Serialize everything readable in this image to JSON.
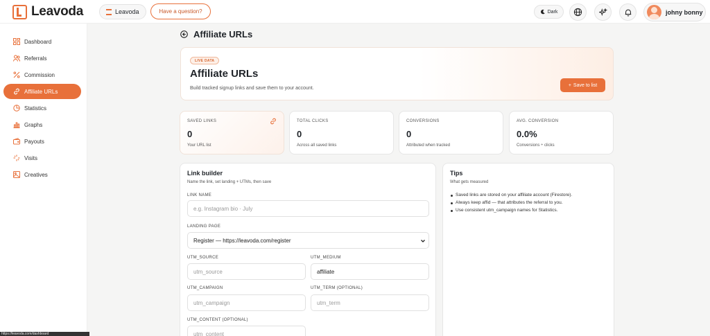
{
  "brand": {
    "logo_text": "Leavoda",
    "pill_label": "Leavoda"
  },
  "topbar": {
    "question_label": "Have a question?",
    "dark_label": "Dark",
    "user_name": "johny bonny"
  },
  "sidebar": {
    "items": [
      {
        "label": "Dashboard",
        "icon": "grid-icon",
        "active": false
      },
      {
        "label": "Referrals",
        "icon": "users-icon",
        "active": false
      },
      {
        "label": "Commission",
        "icon": "percent-icon",
        "active": false
      },
      {
        "label": "Affiliate URLs",
        "icon": "link-icon",
        "active": true
      },
      {
        "label": "Statistics",
        "icon": "pie-icon",
        "active": false
      },
      {
        "label": "Graphs",
        "icon": "bar-chart-icon",
        "active": false
      },
      {
        "label": "Payouts",
        "icon": "wallet-icon",
        "active": false
      },
      {
        "label": "Visits",
        "icon": "sparkle-icon",
        "active": false
      },
      {
        "label": "Creatives",
        "icon": "image-icon",
        "active": false
      }
    ]
  },
  "page": {
    "title": "Affiliate URLs"
  },
  "hero": {
    "badge": "LIVE DATA",
    "title": "Affiliate URLs",
    "subtitle": "Build tracked signup links and save them to your account.",
    "save_label": "Save to list"
  },
  "stats": [
    {
      "label": "SAVED LINKS",
      "value": "0",
      "sub": "Your URL list"
    },
    {
      "label": "TOTAL CLICKS",
      "value": "0",
      "sub": "Across all saved links"
    },
    {
      "label": "CONVERSIONS",
      "value": "0",
      "sub": "Attributed when tracked"
    },
    {
      "label": "AVG. CONVERSION",
      "value": "0.0%",
      "sub": "Conversions ÷ clicks"
    }
  ],
  "builder": {
    "title": "Link builder",
    "subtitle": "Name the link, set landing + UTMs, then save",
    "link_name_label": "LINK NAME",
    "link_name_placeholder": "e.g. Instagram bio · July",
    "landing_label": "LANDING PAGE",
    "landing_value": "Register — https://leavoda.com/register",
    "utm_source_label": "UTM_SOURCE",
    "utm_source_placeholder": "utm_source",
    "utm_medium_label": "UTM_MEDIUM",
    "utm_medium_value": "affiliate",
    "utm_campaign_label": "UTM_CAMPAIGN",
    "utm_campaign_placeholder": "utm_campaign",
    "utm_term_label": "UTM_TERM (OPTIONAL)",
    "utm_term_placeholder": "utm_term",
    "utm_content_label": "UTM_CONTENT (OPTIONAL)",
    "utm_content_placeholder": "utm_content"
  },
  "tips": {
    "title": "Tips",
    "subtitle": "What gets measured",
    "items": [
      "Saved links are stored on your affiliate account (Firestore).",
      "Always keep affid — that attributes the referral to you.",
      "Use consistent utm_campaign names for Statistics."
    ]
  },
  "status_url": "https://leavoda.com/dashboard",
  "colors": {
    "accent": "#e8703a"
  }
}
